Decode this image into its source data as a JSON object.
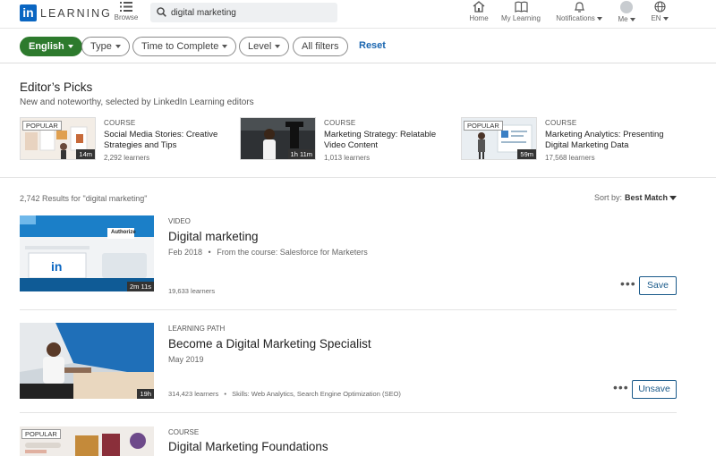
{
  "nav": {
    "logo_mark": "in",
    "logo_text": "LEARNING",
    "browse": "Browse",
    "search_value": "digital marketing",
    "home": "Home",
    "my_learning": "My Learning",
    "notifications": "Notifications",
    "me": "Me",
    "language": "EN"
  },
  "filters": {
    "language": "English",
    "type": "Type",
    "time": "Time to Complete",
    "level": "Level",
    "all": "All filters",
    "reset": "Reset"
  },
  "picks": {
    "title": "Editor’s Picks",
    "subtitle": "New and noteworthy, selected by LinkedIn Learning editors",
    "items": [
      {
        "badge": "POPULAR",
        "type": "COURSE",
        "title": "Social Media Stories: Creative Strategies and Tips",
        "learners": "2,292 learners",
        "duration": "14m"
      },
      {
        "badge": "",
        "type": "COURSE",
        "title": "Marketing Strategy: Relatable Video Content",
        "learners": "1,013 learners",
        "duration": "1h 11m"
      },
      {
        "badge": "POPULAR",
        "type": "COURSE",
        "title": "Marketing Analytics: Presenting Digital Marketing Data",
        "learners": "17,568 learners",
        "duration": "59m"
      }
    ]
  },
  "results": {
    "count": "2,742 Results for \"digital marketing\"",
    "sort_label": "Sort by:",
    "sort_value": "Best Match",
    "items": [
      {
        "type": "VIDEO",
        "title": "Digital marketing",
        "date": "Feb 2018",
        "source": "From the course: Salesforce for Marketers",
        "learners": "19,633 learners",
        "duration": "2m 11s",
        "button": "Save",
        "thumb_label": "Authorize",
        "thumb_mark": "in"
      },
      {
        "type": "LEARNING PATH",
        "title": "Become a Digital Marketing Specialist",
        "date": "May 2019",
        "learners": "314,423 learners",
        "skills": "Skills: Web Analytics, Search Engine Optimization (SEO)",
        "duration": "19h",
        "button": "Unsave"
      },
      {
        "type": "COURSE",
        "title": "Digital Marketing Foundations",
        "badge": "POPULAR"
      }
    ]
  },
  "colors": {
    "brand_blue": "#0a66c2",
    "filter_active": "#2d7a2d",
    "link_blue": "#1a66b0"
  }
}
